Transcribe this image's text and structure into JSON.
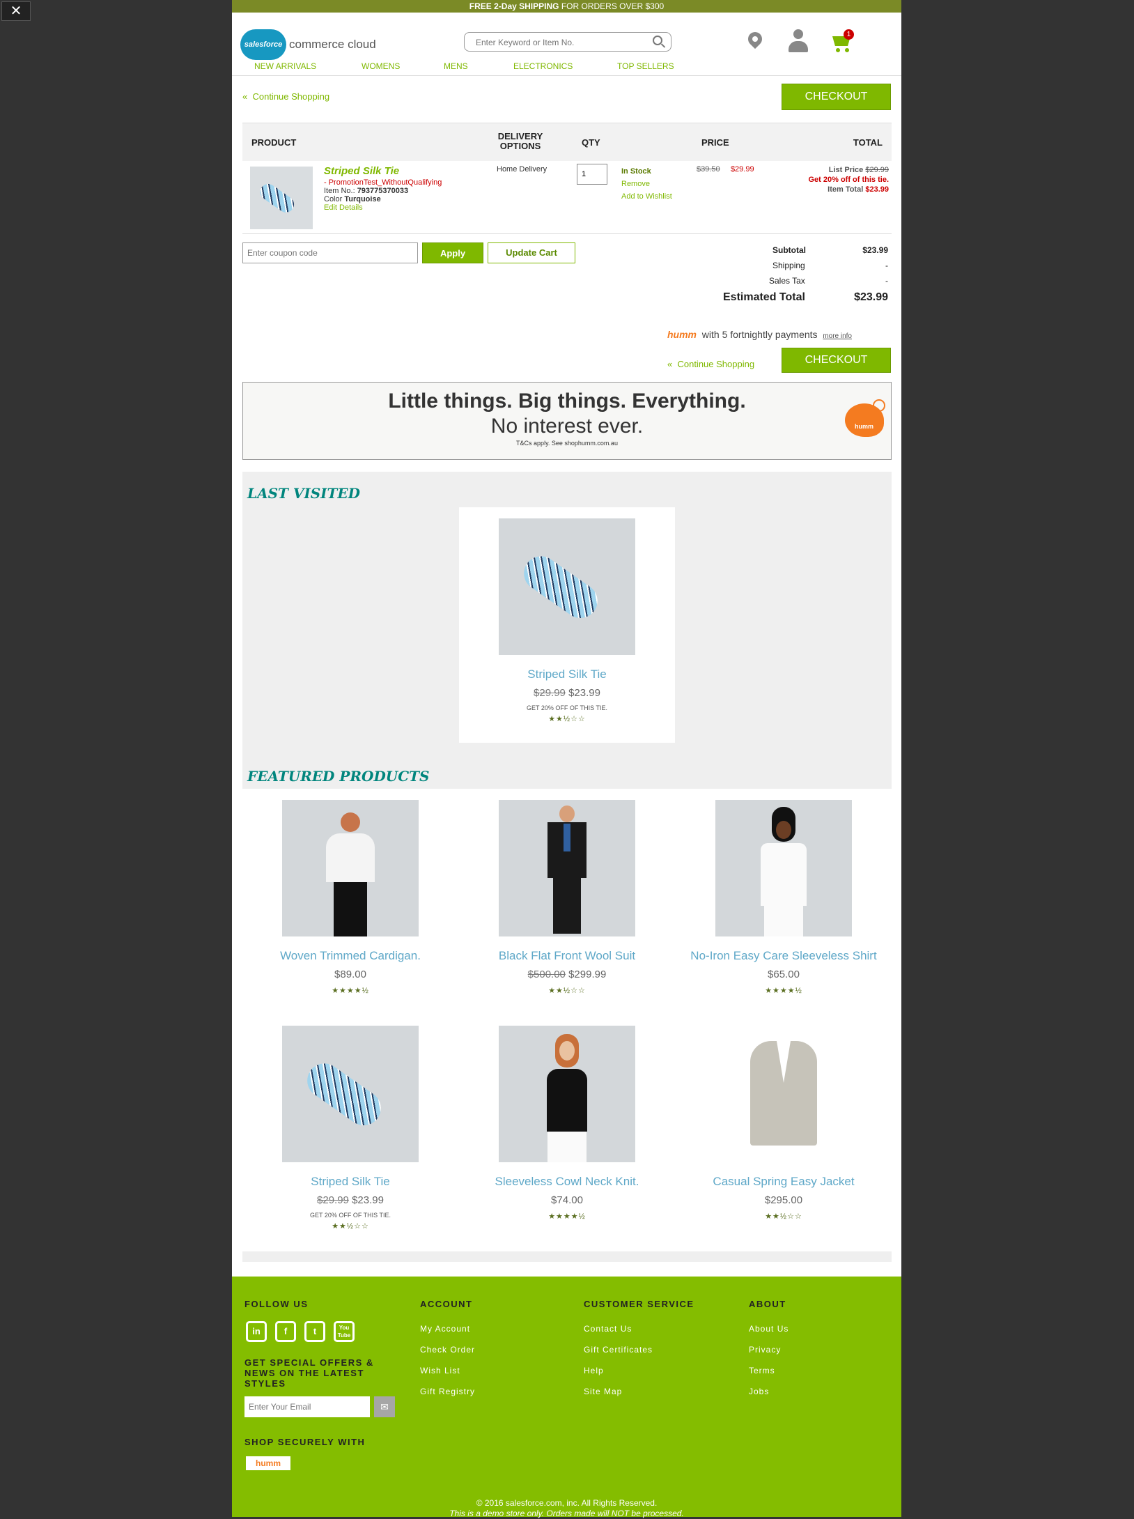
{
  "promo": {
    "bold": "FREE 2-Day SHIPPING",
    "rest": " FOR ORDERS OVER $300"
  },
  "header": {
    "logo_cloud": "salesforce",
    "logo_text": "commerce cloud",
    "search_placeholder": "Enter Keyword or Item No.",
    "cart_count": "1"
  },
  "nav": [
    "NEW ARRIVALS",
    "WOMENS",
    "MENS",
    "ELECTRONICS",
    "TOP SELLERS"
  ],
  "cart": {
    "continue": "Continue Shopping",
    "checkout": "CHECKOUT",
    "headers": {
      "product": "PRODUCT",
      "delivery": "DELIVERY OPTIONS",
      "qty": "QTY",
      "price": "PRICE",
      "total": "TOTAL"
    },
    "item": {
      "name": "Striped Silk Tie",
      "promo": "- PromotionTest_WithoutQualifying",
      "item_no_label": "Item No.: ",
      "item_no": "793775370033",
      "color_label": "Color ",
      "color": "Turquoise",
      "edit": "Edit Details",
      "delivery": "Home Delivery",
      "qty": "1",
      "stock": "In Stock",
      "remove": "Remove",
      "wishlist": "Add to Wishlist",
      "price_old": "$39.50",
      "price_new": "$29.99",
      "list_price_label": "List Price",
      "list_price": "$29.99",
      "discount": "Get 20% off of this tie.",
      "item_total_label": "Item Total",
      "item_total": "$23.99"
    },
    "coupon_placeholder": "Enter coupon code",
    "apply": "Apply",
    "update": "Update Cart",
    "summary": {
      "subtotal_label": "Subtotal",
      "subtotal": "$23.99",
      "shipping_label": "Shipping",
      "shipping": "-",
      "tax_label": "Sales Tax",
      "tax": "-",
      "est_label": "Estimated Total",
      "est": "$23.99"
    },
    "humm": {
      "logo": "humm",
      "text": "with 5 fortnightly payments",
      "more": "more info"
    }
  },
  "banner": {
    "line1": "Little things. Big things. Everything.",
    "line2": "No interest ever.",
    "fine": "T&Cs apply. See shophumm.com.au",
    "bird": "humm"
  },
  "last_visited": {
    "title": "LAST VISITED",
    "item": {
      "name": "Striped Silk Tie",
      "old": "$29.99",
      "price": "$23.99",
      "promo": "Get 20% off of this tie.",
      "stars": "★★½☆☆"
    }
  },
  "featured": {
    "title": "FEATURED PRODUCTS",
    "items": [
      {
        "name": "Woven Trimmed Cardigan.",
        "old": "",
        "price": "$89.00",
        "promo": "",
        "stars": "★★★★½"
      },
      {
        "name": "Black Flat Front Wool Suit",
        "old": "$500.00",
        "price": "$299.99",
        "promo": "",
        "stars": "★★½☆☆"
      },
      {
        "name": "No-Iron Easy Care Sleeveless Shirt",
        "old": "",
        "price": "$65.00",
        "promo": "",
        "stars": "★★★★½"
      },
      {
        "name": "Striped Silk Tie",
        "old": "$29.99",
        "price": "$23.99",
        "promo": "Get 20% off of this tie.",
        "stars": "★★½☆☆"
      },
      {
        "name": "Sleeveless Cowl Neck Knit.",
        "old": "",
        "price": "$74.00",
        "promo": "",
        "stars": "★★★★½"
      },
      {
        "name": "Casual Spring Easy Jacket",
        "old": "",
        "price": "$295.00",
        "promo": "",
        "stars": "★★½☆☆"
      }
    ]
  },
  "footer": {
    "follow": "FOLLOW US",
    "social": [
      "in",
      "f",
      "t",
      "You Tube"
    ],
    "offers": "GET SPECIAL OFFERS & NEWS ON THE LATEST STYLES",
    "email_placeholder": "Enter Your Email",
    "secure": "SHOP SECURELY WITH",
    "humm": "humm",
    "account": {
      "title": "ACCOUNT",
      "links": [
        "My Account",
        "Check Order",
        "Wish List",
        "Gift Registry"
      ]
    },
    "service": {
      "title": "CUSTOMER SERVICE",
      "links": [
        "Contact Us",
        "Gift Certificates",
        "Help",
        "Site Map"
      ]
    },
    "about": {
      "title": "ABOUT",
      "links": [
        "About Us",
        "Privacy",
        "Terms",
        "Jobs"
      ]
    },
    "copyright": "© 2016 salesforce.com, inc. All Rights Reserved.",
    "demo": "This is a demo store only. Orders made will NOT be processed."
  }
}
